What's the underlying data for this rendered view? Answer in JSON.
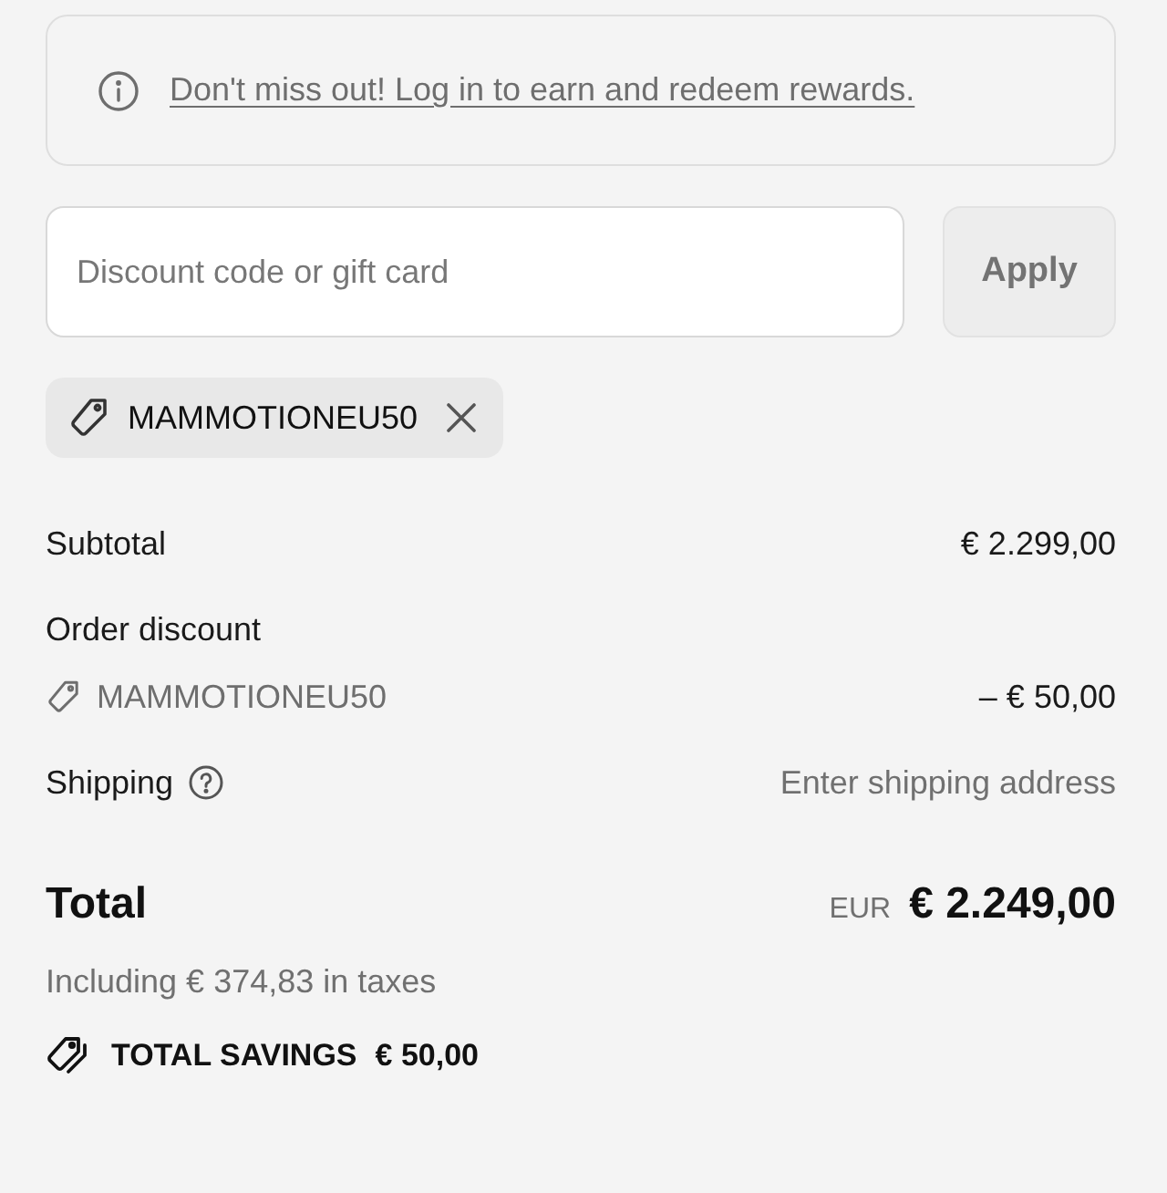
{
  "rewards_banner": {
    "text": "Don't miss out! Log in to earn and redeem rewards."
  },
  "discount_form": {
    "placeholder": "Discount code or gift card",
    "apply_button": "Apply"
  },
  "applied_codes": [
    {
      "code": "MAMMOTIONEU50"
    }
  ],
  "summary_lines": [
    {
      "kind": "plain",
      "label": "Subtotal",
      "value": "€ 2.299,00"
    },
    {
      "kind": "discount",
      "label": "Order discount",
      "code": "MAMMOTIONEU50",
      "value": "– € 50,00"
    },
    {
      "kind": "help",
      "label": "Shipping",
      "value": "Enter shipping address"
    }
  ],
  "total": {
    "label": "Total",
    "currency": "EUR",
    "amount": "€ 2.249,00",
    "taxes_note": "Including € 374,83 in taxes"
  },
  "savings": {
    "label": "TOTAL SAVINGS",
    "amount": "€ 50,00"
  }
}
